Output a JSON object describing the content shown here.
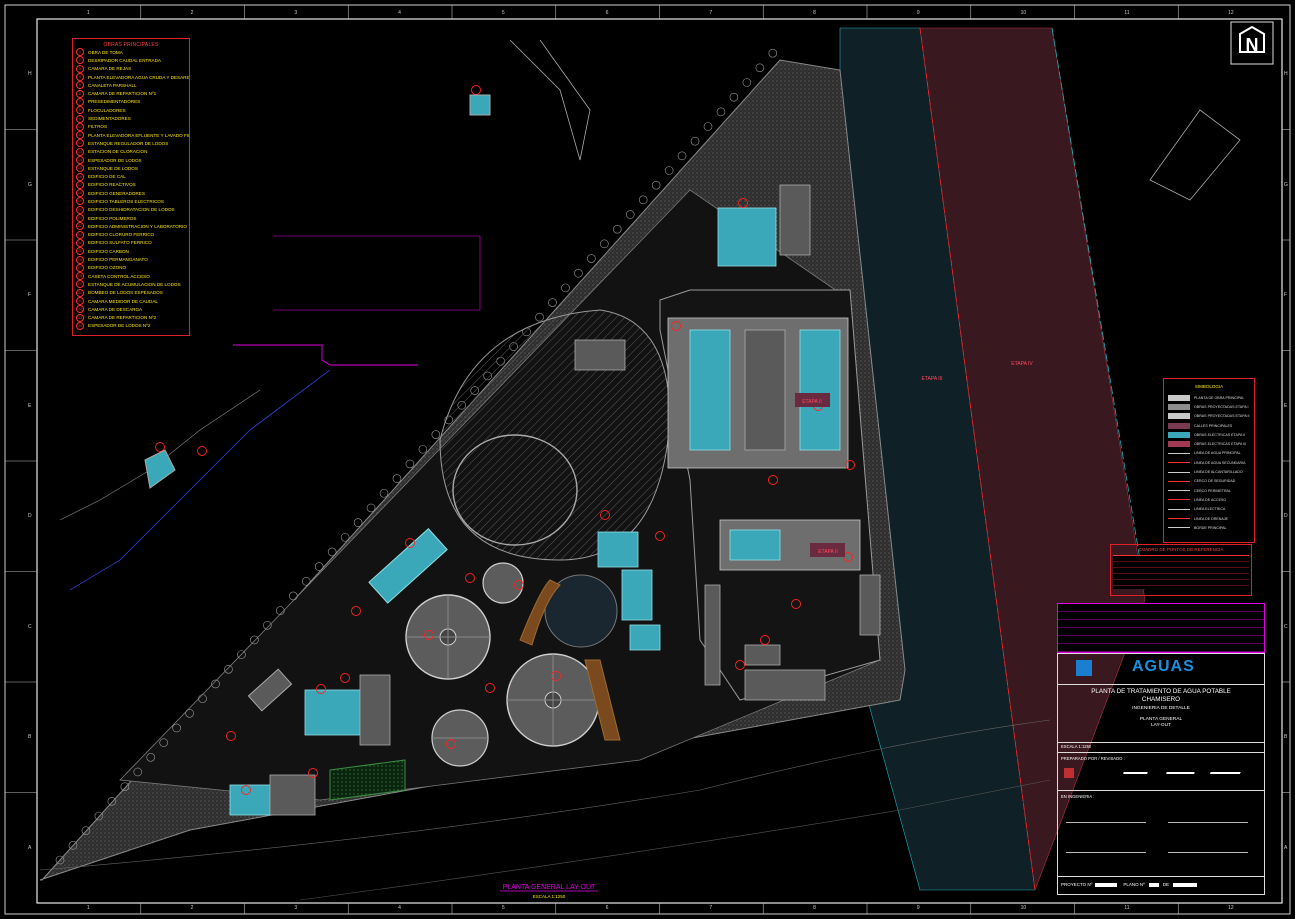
{
  "legend": {
    "title": "OBRAS PRINCIPALES",
    "items": [
      "OBRA DE TOMA",
      "DESRIPADOR CAUDAL ENTRADA",
      "CAMARA DE REJAS",
      "PLANTA ELEVADORA AGUA CRUDA Y DESARENADORES",
      "CANALETA PARSHALL",
      "CAMARA DE REPARTICION Nº1",
      "PRESEDIMENTADORES",
      "FLOCULADORES",
      "SEDIMENTADORES",
      "FILTROS",
      "PLANTA ELEVADORA EFLUENTE Y LAVADO FILTROS",
      "ESTANQUE REGULADOR DE LODOS",
      "ESTACION DE CLORACION",
      "ESPESADOR DE LODOS",
      "ESTANQUE DE LODOS",
      "EDIFICIO DE CAL",
      "EDIFICIO REACTIVOS",
      "EDIFICIO GENERADORES",
      "EDIFICIO TABLEROS ELECTRICOS",
      "EDIFICIO DESHIDRATACION DE LODOS",
      "EDIFICIO POLIMEROS",
      "EDIFICIO ADMINISTRACION Y LABORATORIO",
      "EDIFICIO CLORURO FERRICO",
      "EDIFICIO SULFATO FERRICO",
      "EDIFICIO CARBON",
      "EDIFICIO PERMANGANATO",
      "EDIFICIO OZONO",
      "CASETA CONTROL ACCESO",
      "ESTANQUE DE ACUMULACION DE LODOS",
      "BOMBEO DE LODOS ESPESADOS",
      "CAMARA MEDIDOR DE CAUDAL",
      "CAMARA DE DESCARGA",
      "CAMARA DE REPARTICION Nº2",
      "ESPESADOR DE LODOS Nº2"
    ]
  },
  "simbologia": {
    "title": "SIMBOLOGIA",
    "items": [
      "PLANTA DE OBRA PRINCIPAL",
      "OBRAS PROYECTADAS ETAPA I",
      "OBRAS PROYECTADAS ETAPA II",
      "CALLES PRINCIPALES",
      "OBRAS ELECTRICAS ETAPA II",
      "OBRAS ELECTRICAS ETAPA III",
      "LINEA DE AGUA PRINCIPAL",
      "LINEA DE AGUA SECUNDARIA",
      "LINEA DE ALCANTARILLADO",
      "CERCO DE SEGURIDAD",
      "CERCO PERIMETRAL",
      "LINEA DE ACCESO",
      "LINEA ELECTRICA",
      "LINEA DE DRENAJE",
      "BORDE PRINCIPAL"
    ],
    "colors": [
      "#c8c8c8",
      "#8c8c8c",
      "#c8c8c8",
      "#7a3a52",
      "#3aa8b8",
      "#a03a52"
    ]
  },
  "referencias": {
    "title": "CUADRO DE PUNTOS DE REFERENCIA"
  },
  "titleblock": {
    "logo": "AGUAS",
    "project": "PLANTA DE TRATAMIENTO DE AGUA POTABLE",
    "site": "CHAMISERO",
    "phase": "INGENIERIA DE DETALLE",
    "drawing": "PLANTA GENERAL",
    "drawing2": "LAY-OUT",
    "scale": "ESCALA 1:1250",
    "approved": "PREPARADO POR / REVISADO :",
    "ingenieria": "EN INGENIERIA :",
    "proyecto": "PROYECTO Nº",
    "plano": "PLANO Nº",
    "de": "DE"
  },
  "labels": {
    "etapa1": "ETAPA III",
    "etapa2": "ETAPA IV",
    "etapa_b": "ETAPA II",
    "etapa_c": "ETAPA II",
    "north": "N",
    "plan_title": "PLANTA GENERAL LAY-OUT",
    "plan_scale": "ESCALA 1:1250"
  },
  "grid": {
    "cols": [
      "1",
      "2",
      "3",
      "4",
      "5",
      "6",
      "7",
      "8",
      "9",
      "10",
      "11",
      "12"
    ],
    "rows": [
      "H",
      "G",
      "F",
      "E",
      "D",
      "C",
      "B",
      "A"
    ]
  },
  "colors": {
    "bg": "#000000",
    "site": "#3a3a3a",
    "teal": "#20b0b8",
    "red": "#ff2020",
    "magenta": "#e000e0",
    "yellow": "#ffe600",
    "maroon": "#3a1a22",
    "darkteal": "#0e2228"
  }
}
